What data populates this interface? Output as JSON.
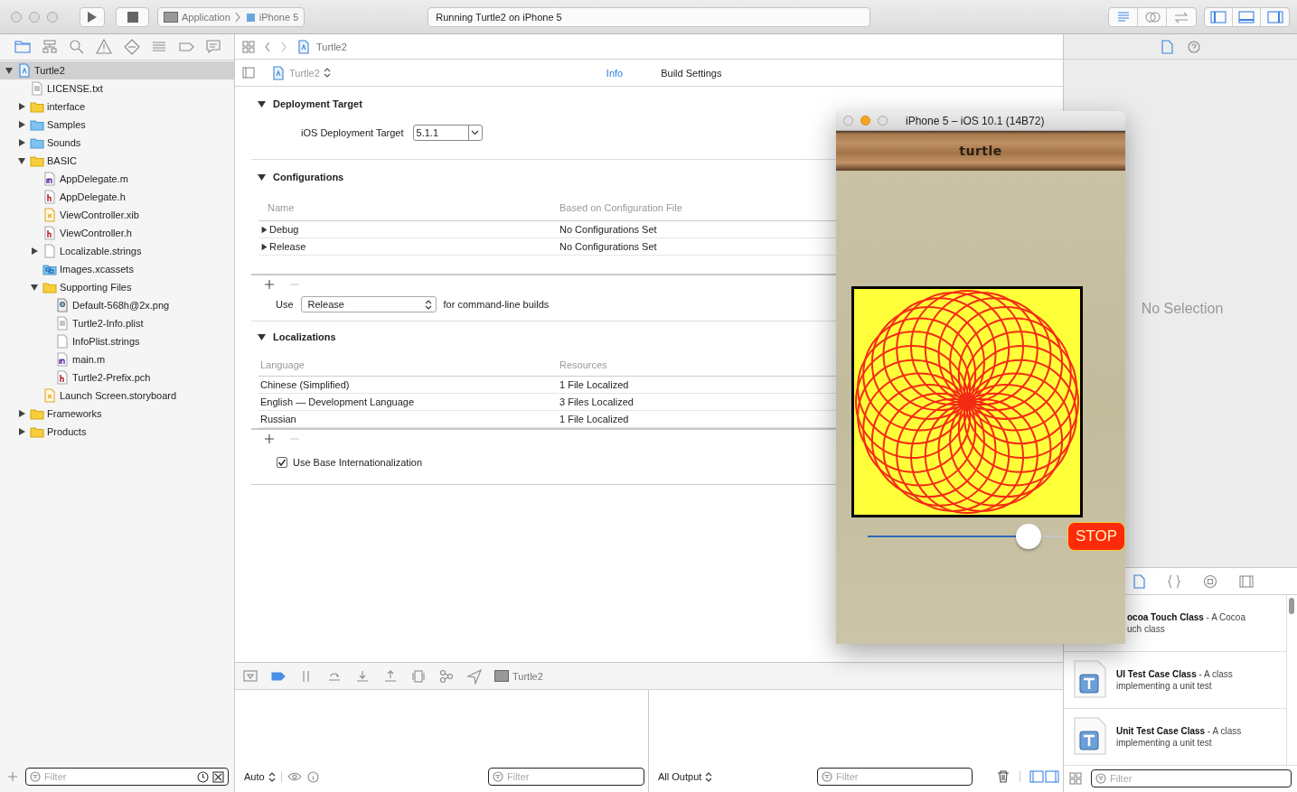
{
  "toolbar": {
    "scheme": {
      "target": "Application",
      "device": "iPhone 5"
    },
    "activity": "Running Turtle2 on iPhone 5",
    "editor_modes": [
      {
        "selected": true
      },
      {
        "selected": false
      },
      {
        "selected": false
      }
    ],
    "panels": [
      {
        "on": true
      },
      {
        "on": true
      },
      {
        "on": true
      }
    ]
  },
  "navigator": {
    "tree": [
      {
        "name": "Turtle2",
        "kind": "project",
        "selected": true,
        "expanded": true,
        "children": [
          {
            "name": "LICENSE.txt",
            "kind": "text",
            "selected": false
          },
          {
            "name": "interface",
            "kind": "folder",
            "selected": false,
            "expanded": false
          },
          {
            "name": "Samples",
            "kind": "blue-folder",
            "selected": false,
            "expanded": false
          },
          {
            "name": "Sounds",
            "kind": "blue-folder",
            "selected": false,
            "expanded": false
          },
          {
            "name": "BASIC",
            "kind": "folder",
            "selected": false,
            "expanded": true,
            "children": [
              {
                "name": "AppDelegate.m",
                "kind": "m",
                "selected": false
              },
              {
                "name": "AppDelegate.h",
                "kind": "h",
                "selected": false
              },
              {
                "name": "ViewController.xib",
                "kind": "xib",
                "selected": false
              },
              {
                "name": "ViewController.h",
                "kind": "h",
                "selected": false
              },
              {
                "name": "Localizable.strings",
                "kind": "blank",
                "selected": false,
                "expanded": false
              },
              {
                "name": "Images.xcassets",
                "kind": "assets",
                "selected": false
              },
              {
                "name": "Supporting Files",
                "kind": "folder",
                "selected": false,
                "expanded": true,
                "children": [
                  {
                    "name": "Default-568h@2x.png",
                    "kind": "image",
                    "selected": false
                  },
                  {
                    "name": "Turtle2-Info.plist",
                    "kind": "text",
                    "selected": false
                  },
                  {
                    "name": "InfoPlist.strings",
                    "kind": "blank",
                    "selected": false
                  },
                  {
                    "name": "main.m",
                    "kind": "m",
                    "selected": false
                  },
                  {
                    "name": "Turtle2-Prefix.pch",
                    "kind": "h",
                    "selected": false
                  }
                ]
              },
              {
                "name": "Launch Screen.storyboard",
                "kind": "xib",
                "selected": false
              }
            ]
          },
          {
            "name": "Frameworks",
            "kind": "folder",
            "selected": false,
            "expanded": false
          },
          {
            "name": "Products",
            "kind": "folder",
            "selected": false,
            "expanded": false
          }
        ]
      }
    ],
    "filter": {
      "placeholder": "Filter"
    }
  },
  "editor": {
    "breadcrumb": "Turtle2",
    "target": "Turtle2",
    "tabs": [
      {
        "label": "Info",
        "selected": true
      },
      {
        "label": "Build Settings",
        "selected": false
      }
    ],
    "deployment": {
      "title": "Deployment Target",
      "expanded": true,
      "label": "iOS Deployment Target",
      "value": "5.1.1"
    },
    "configurations": {
      "title": "Configurations",
      "expanded": true,
      "columns": [
        "Name",
        "Based on Configuration File"
      ],
      "rows": [
        {
          "name": "Debug",
          "file": "No Configurations Set",
          "expanded": false
        },
        {
          "name": "Release",
          "file": "No Configurations Set",
          "expanded": false
        }
      ],
      "use_label": "Use",
      "use_value": "Release",
      "use_suffix": "for command-line builds"
    },
    "localizations": {
      "title": "Localizations",
      "expanded": true,
      "columns": [
        "Language",
        "Resources"
      ],
      "rows": [
        {
          "language": "Chinese (Simplified)",
          "resources": "1 File Localized"
        },
        {
          "language": "English — Development Language",
          "resources": "3 Files Localized"
        },
        {
          "language": "Russian",
          "resources": "1 File Localized"
        }
      ],
      "base": {
        "label": "Use Base Internationalization",
        "checked": true
      }
    }
  },
  "debug": {
    "process": "Turtle2",
    "variables": {
      "mode": "Auto",
      "filter": {
        "placeholder": "Filter"
      }
    },
    "console": {
      "mode": "All Output",
      "filter": {
        "placeholder": "Filter"
      }
    }
  },
  "inspector": {
    "empty": "No Selection",
    "library": {
      "items": [
        {
          "kind": "clipped",
          "title": "ocoa Touch Class",
          "desc": [
            "- A Cocoa",
            "uch class"
          ]
        },
        {
          "kind": "template",
          "title": "UI Test Case Class",
          "desc": [
            "- A class",
            "implementing a unit test"
          ]
        },
        {
          "kind": "template",
          "title": "Unit Test Case Class",
          "desc": [
            "- A class",
            "implementing a unit test"
          ]
        }
      ],
      "filter": {
        "placeholder": "Filter"
      }
    }
  },
  "simulator": {
    "title": "iPhone 5 – iOS 10.1 (14B72)",
    "app_title": "turtle",
    "slider": {
      "level": 0.81
    },
    "button": "STOP"
  }
}
